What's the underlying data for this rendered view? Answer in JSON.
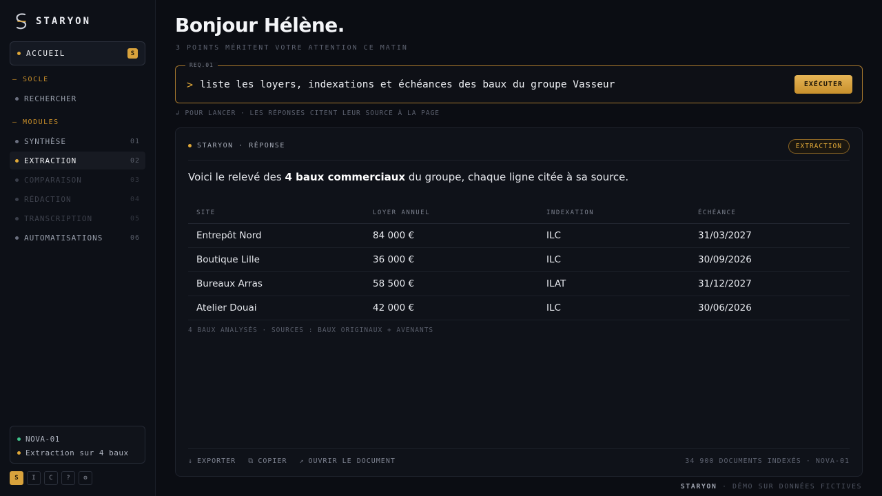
{
  "brand": {
    "name": "STARYON",
    "logo_icon": "staryon-logo-icon"
  },
  "sidebar": {
    "home": {
      "label": "ACCUEIL",
      "shortcut": "S"
    },
    "sections": [
      {
        "title": "— SOCLE",
        "items": [
          {
            "label": "RECHERCHER",
            "num": ""
          }
        ]
      },
      {
        "title": "— MODULES",
        "items": [
          {
            "label": "SYNTHÈSE",
            "num": "01"
          },
          {
            "label": "EXTRACTION",
            "num": "02"
          },
          {
            "label": "COMPARAISON",
            "num": "03"
          },
          {
            "label": "RÉDACTION",
            "num": "04"
          },
          {
            "label": "TRANSCRIPTION",
            "num": "05"
          },
          {
            "label": "AUTOMATISATIONS",
            "num": "06"
          }
        ]
      }
    ],
    "status": {
      "node": "NOVA-01",
      "task": "Extraction sur 4 baux"
    },
    "shortcuts": [
      "S",
      "I",
      "C",
      "?",
      "⚙"
    ]
  },
  "header": {
    "greeting": "Bonjour Hélène.",
    "subtitle": "3 POINTS MÉRITENT VOTRE ATTENTION CE MATIN"
  },
  "query": {
    "tag": "REQ.01",
    "prompt": ">",
    "text": "liste les loyers, indexations et échéances des baux du groupe Vasseur",
    "run_label": "EXÉCUTER",
    "hint": "↲ POUR LANCER · LES RÉPONSES CITENT LEUR SOURCE À LA PAGE"
  },
  "response": {
    "source_label": "STARYON · RÉPONSE",
    "module_tag": "EXTRACTION",
    "intro_before": "Voici le relevé des ",
    "intro_bold": "4 baux commerciaux",
    "intro_after": " du groupe, chaque ligne citée à sa source.",
    "columns": [
      "SITE",
      "LOYER ANNUEL",
      "INDEXATION",
      "ÉCHÉANCE"
    ],
    "rows": [
      [
        "Entrepôt Nord",
        "84 000 €",
        "ILC",
        "31/03/2027"
      ],
      [
        "Boutique Lille",
        "36 000 €",
        "ILC",
        "30/09/2026"
      ],
      [
        "Bureaux Arras",
        "58 500 €",
        "ILAT",
        "31/12/2027"
      ],
      [
        "Atelier Douai",
        "42 000 €",
        "ILC",
        "30/06/2026"
      ]
    ],
    "table_footnote": "4 BAUX ANALYSÉS · SOURCES : BAUX ORIGINAUX + AVENANTS",
    "actions": [
      {
        "icon": "↓",
        "label": "EXPORTER"
      },
      {
        "icon": "⧉",
        "label": "COPIER"
      },
      {
        "icon": "↗",
        "label": "OUVRIR LE DOCUMENT"
      }
    ],
    "meta": "34 900 DOCUMENTS INDEXÉS · NOVA-01"
  },
  "footer": {
    "brand": "STARYON",
    "text": " · DÉMO SUR DONNÉES FICTIVES"
  },
  "colors": {
    "accent": "#e0a838",
    "status_ok": "#3fc28a",
    "background": "#0b0d13"
  }
}
